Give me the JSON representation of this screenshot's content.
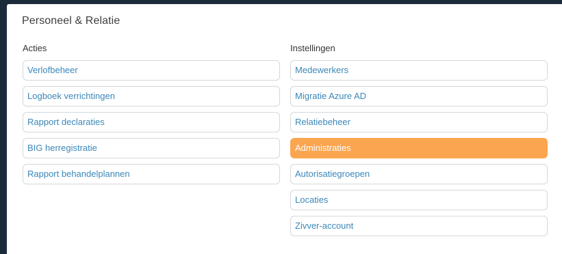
{
  "panel": {
    "title": "Personeel & Relatie"
  },
  "acties": {
    "heading": "Acties",
    "items": [
      {
        "label": "Verlofbeheer"
      },
      {
        "label": "Logboek verrichtingen"
      },
      {
        "label": "Rapport declaraties"
      },
      {
        "label": "BIG herregistratie"
      },
      {
        "label": "Rapport behandelplannen"
      }
    ]
  },
  "instellingen": {
    "heading": "Instellingen",
    "items": [
      {
        "label": "Medewerkers"
      },
      {
        "label": "Migratie Azure AD"
      },
      {
        "label": "Relatiebeheer"
      },
      {
        "label": "Administraties",
        "active": true
      },
      {
        "label": "Autorisatiegroepen"
      },
      {
        "label": "Locaties"
      },
      {
        "label": "Zivver-account"
      }
    ]
  },
  "colors": {
    "background": "#1b2b3b",
    "link": "#3a87b8",
    "active": "#fba550"
  }
}
